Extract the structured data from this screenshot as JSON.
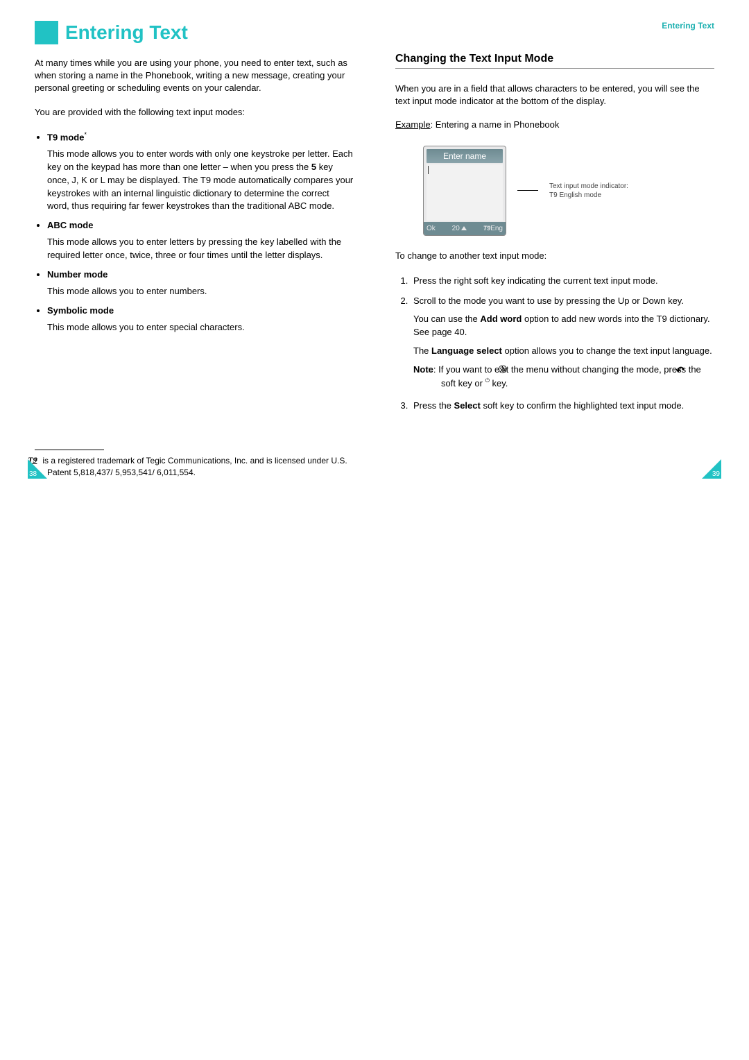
{
  "running_head": "Entering Text",
  "left": {
    "title": "Entering Text",
    "intro_p1": "At many times while you are using your phone, you need to enter text, such as when storing a name in the Phonebook, writing a new message, creating your personal greeting or scheduling events on your calendar.",
    "intro_p2": "You are provided with the following text input modes:",
    "modes": {
      "t9_label": "T9 mode",
      "t9_desc_a": "This mode allows you to enter words with only one keystroke per letter. Each key on the keypad has more than one letter – when you press the ",
      "t9_desc_5": "5",
      "t9_desc_b": " key once, J, K or L may be displayed. The T9 mode automatically compares your keystrokes with an internal linguistic dictionary to determine the correct word, thus requiring far fewer keystrokes than the traditional ABC mode.",
      "abc_label": "ABC mode",
      "abc_desc": "This mode allows you to enter letters by pressing the key labelled with the required letter once, twice, three or four times until the letter displays.",
      "num_label": "Number mode",
      "num_desc": "This mode allows you to enter numbers.",
      "sym_label": "Symbolic mode",
      "sym_desc": "This mode allows you to enter special characters."
    },
    "footnote_star": "*",
    "footnote_t9glyph": "T9",
    "footnote_rest": " is a registered trademark of Tegic Communications, Inc. and is licensed under U.S. Patent 5,818,437/ 5,953,541/ 6,011,554.",
    "page": "38"
  },
  "right": {
    "section_h": "Changing the Text Input Mode",
    "p1": "When you are in a field that allows characters to be entered, you will see the text input mode indicator at the bottom of the display.",
    "example_label": "Example",
    "example_text": ": Entering a name in Phonebook",
    "phone": {
      "title": "Enter name",
      "soft_left": "Ok",
      "char_count": "20",
      "t9": "T9",
      "lang": "Eng",
      "callout1": "Text input mode indicator:",
      "callout2": "T9 English mode"
    },
    "p2": "To change to another text input mode:",
    "step1": "Press the right soft key indicating the current text input mode.",
    "step2": "Scroll to the mode you want to use by pressing the Up or Down key.",
    "step2_sub_a": "You can use the ",
    "step2_addword": "Add word",
    "step2_sub_b": " option to add new words into the T9 dictionary. See page 40.",
    "step2_sub2_a": "The ",
    "step2_langsel": "Language select",
    "step2_sub2_b": " option allows you to change the text input language.",
    "note_label": "Note",
    "note_a": ": If you want to exit the menu without changing the mode, press the ",
    "note_b": " soft key or ",
    "note_c": " key.",
    "step3_a": "Press the ",
    "step3_select": "Select",
    "step3_b": " soft key to confirm the highlighted text input mode.",
    "page": "39"
  }
}
